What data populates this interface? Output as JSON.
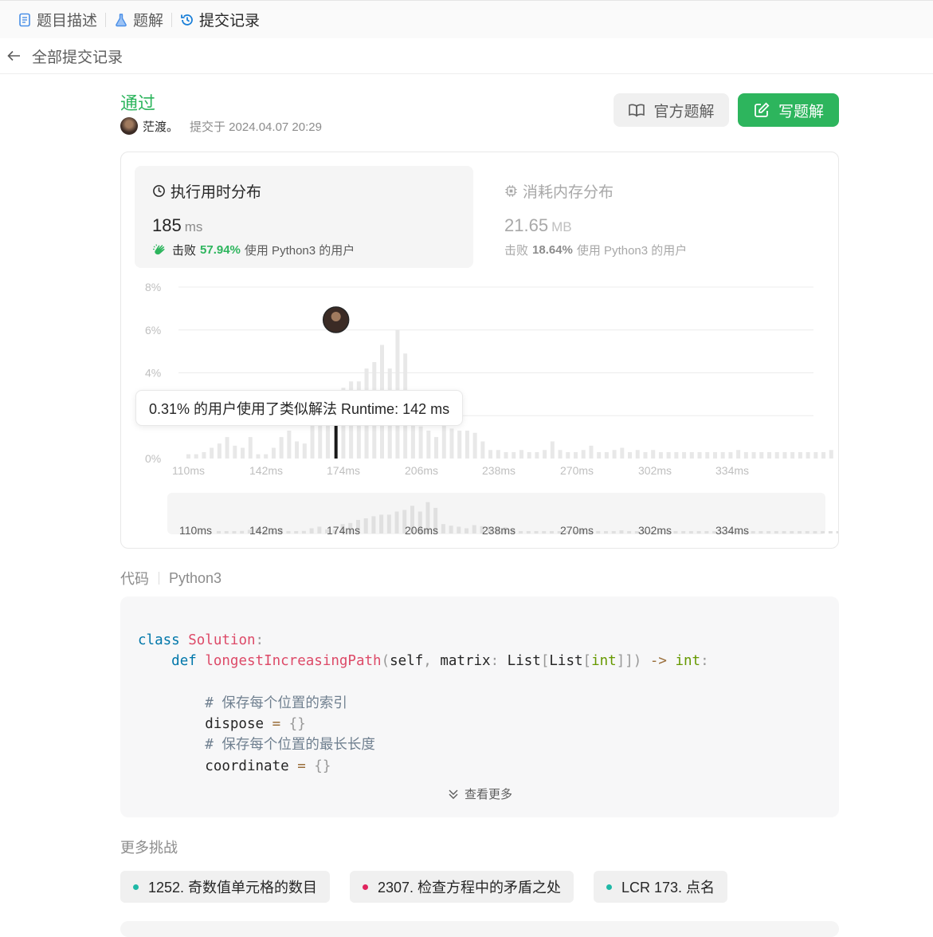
{
  "tabs": [
    {
      "label": "题目描述",
      "icon": "document-icon"
    },
    {
      "label": "题解",
      "icon": "flask-icon"
    },
    {
      "label": "提交记录",
      "icon": "history-icon",
      "active": true
    }
  ],
  "back": {
    "label": "全部提交记录"
  },
  "submission": {
    "status": "通过",
    "user": "茫渡。",
    "submitted_at": "提交于 2024.04.07 20:29"
  },
  "buttons": {
    "official": "官方题解",
    "write": "写题解"
  },
  "runtime": {
    "title": "执行用时分布",
    "value": "185",
    "unit": "ms",
    "beat_prefix": "击败",
    "beat_pct": "57.94%",
    "beat_suffix": "使用 Python3 的用户"
  },
  "memory": {
    "title": "消耗内存分布",
    "value": "21.65",
    "unit": "MB",
    "beat_prefix": "击败",
    "beat_pct": "18.64%",
    "beat_suffix": "使用 Python3 的用户"
  },
  "tooltip": "0.31% 的用户使用了类似解法 Runtime: 142 ms",
  "colors": {
    "accent": "#2db55d",
    "bar": "#e8e8e8",
    "highlight": "#1a1a1a",
    "pink": "#e0245e",
    "teal": "#1fb8a6"
  },
  "chart_data": {
    "type": "bar",
    "ylim": [
      0,
      8
    ],
    "yticks": [
      "0%",
      "4%",
      "6%",
      "8%"
    ],
    "xticks": [
      "110ms",
      "142ms",
      "174ms",
      "206ms",
      "238ms",
      "270ms",
      "302ms",
      "334ms"
    ],
    "x_start": 110,
    "x_step": 4,
    "highlight_x": 186,
    "values": [
      0.2,
      0.2,
      0.3,
      0.5,
      0.7,
      1.0,
      0.6,
      0.5,
      1.0,
      0.2,
      0.2,
      0.5,
      1.0,
      1.3,
      0.8,
      0.7,
      1.8,
      2.0,
      2.6,
      2.9,
      3.3,
      3.6,
      3.6,
      4.2,
      4.5,
      5.3,
      4.2,
      6.0,
      4.9,
      1.8,
      1.5,
      1.3,
      1.0,
      1.6,
      1.4,
      1.3,
      1.3,
      1.2,
      0.8,
      0.4,
      0.4,
      0.3,
      0.3,
      0.4,
      0.3,
      0.3,
      0.4,
      0.8,
      0.4,
      0.3,
      0.3,
      0.4,
      0.6,
      0.3,
      0.3,
      0.4,
      0.5,
      0.3,
      0.4,
      0.3,
      0.4,
      0.3,
      0.3,
      0.3,
      0.3,
      0.3,
      0.3,
      0.3,
      0.3,
      0.3,
      0.3,
      0.4,
      0.3,
      0.3,
      0.3,
      0.3,
      0.3,
      0.3,
      0.3,
      0.3,
      0.3,
      0.3,
      0.3,
      0.4
    ]
  },
  "code": {
    "label": "代码",
    "language": "Python3",
    "more": "查看更多"
  },
  "challenges": {
    "title": "更多挑战",
    "items": [
      {
        "label": "1252. 奇数值单元格的数目",
        "dot": "#1fb8a6"
      },
      {
        "label": "2307. 检查方程中的矛盾之处",
        "dot": "#e0245e"
      },
      {
        "label": "LCR 173. 点名",
        "dot": "#1fb8a6"
      }
    ]
  }
}
